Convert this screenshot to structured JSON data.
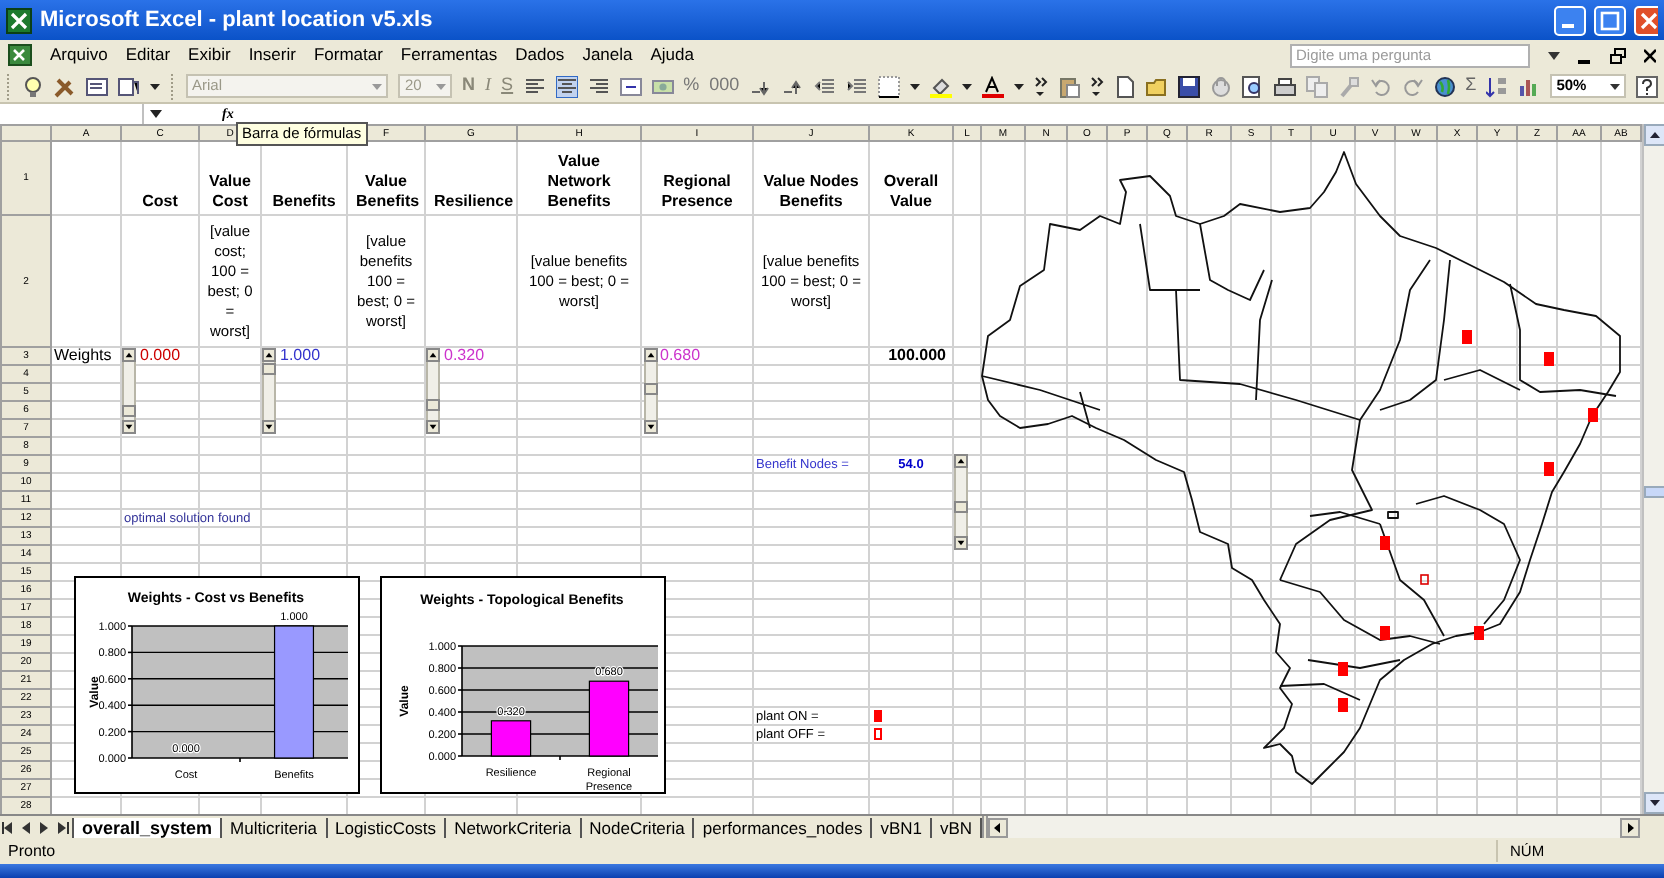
{
  "window": {
    "title": "Microsoft Excel - plant location v5.xls"
  },
  "menu": [
    "Arquivo",
    "Editar",
    "Exibir",
    "Inserir",
    "Formatar",
    "Ferramentas",
    "Dados",
    "Janela",
    "Ajuda"
  ],
  "help_search": {
    "placeholder": "Digite uma pergunta"
  },
  "toolbar": {
    "font": "Arial",
    "font_size": "20",
    "format_buttons": [
      "N",
      "I",
      "S"
    ],
    "percent": "%",
    "thousands": "000",
    "sum": "Σ",
    "zoom": "50%"
  },
  "formula_bar": {
    "function_label": "fx",
    "tooltip": "Barra de fórmulas"
  },
  "columns": [
    "A",
    "C",
    "D",
    "F",
    "G",
    "H",
    "I",
    "J",
    "K",
    "L",
    "M",
    "N",
    "O",
    "P",
    "Q",
    "R",
    "S",
    "T",
    "U",
    "V",
    "W",
    "X",
    "Y",
    "Z",
    "AA",
    "AB"
  ],
  "rows": [
    {
      "number": "1",
      "cells": {
        "C": {
          "text": "Cost",
          "kind": "header"
        },
        "D": {
          "text": "Value Cost",
          "kind": "header"
        },
        "E": {
          "text": "Benefits",
          "kind": "header"
        },
        "F": {
          "text": "Value Benefits",
          "kind": "header"
        },
        "G": {
          "text": "Resilience",
          "kind": "header"
        },
        "H": {
          "text": "Value Network Benefits",
          "kind": "header"
        },
        "I": {
          "text": "Regional Presence",
          "kind": "header"
        },
        "J": {
          "text": "Value Nodes Benefits",
          "kind": "header"
        },
        "K": {
          "text": "Overall Value",
          "kind": "header"
        }
      }
    },
    {
      "number": "2",
      "cells": {
        "D": {
          "text": "[value cost; 100 = best; 0 = worst]",
          "kind": "note"
        },
        "F": {
          "text": "[value benefits 100 = best; 0 = worst]",
          "kind": "note"
        },
        "H": {
          "text": "[value benefits 100 = best; 0 = worst]",
          "kind": "note"
        },
        "J": {
          "text": "[value benefits 100 = best; 0 = worst]",
          "kind": "note"
        }
      }
    },
    {
      "number": "3",
      "cells": {
        "A": {
          "text": "Weights",
          "kind": "label"
        },
        "C": {
          "text": "0.000",
          "kind": "value",
          "color": "#cc0000"
        },
        "E": {
          "text": "1.000",
          "kind": "value",
          "color": "#3333cc"
        },
        "G": {
          "text": "0.320",
          "kind": "value",
          "color": "#cc33cc"
        },
        "I": {
          "text": "0.680",
          "kind": "value",
          "color": "#cc33cc"
        },
        "K": {
          "text": "100.000",
          "kind": "total"
        }
      }
    },
    {
      "number": "4"
    },
    {
      "number": "5"
    },
    {
      "number": "6"
    },
    {
      "number": "7"
    },
    {
      "number": "8"
    },
    {
      "number": "9",
      "cells": {
        "J": {
          "text": "Benefit Nodes =",
          "kind": "small",
          "color": "#3333cc"
        },
        "K": {
          "text": "54.0",
          "kind": "small-total",
          "color": "#0000cc"
        }
      }
    },
    {
      "number": "10"
    },
    {
      "number": "11"
    },
    {
      "number": "12",
      "cells": {
        "C": {
          "text": "optimal solution found",
          "kind": "small",
          "color": "#333399"
        }
      }
    },
    {
      "number": "13"
    },
    {
      "number": "14"
    },
    {
      "number": "15"
    },
    {
      "number": "16"
    },
    {
      "number": "17"
    },
    {
      "number": "18"
    },
    {
      "number": "19"
    },
    {
      "number": "20"
    },
    {
      "number": "21"
    },
    {
      "number": "22"
    },
    {
      "number": "23",
      "cells": {
        "J": {
          "text": "plant ON =",
          "kind": "small"
        },
        "K": {
          "kind": "marker",
          "on": true
        }
      }
    },
    {
      "number": "24",
      "cells": {
        "J": {
          "text": "plant OFF =",
          "kind": "small"
        },
        "K": {
          "kind": "marker",
          "on": false
        }
      }
    },
    {
      "number": "25"
    },
    {
      "number": "26"
    },
    {
      "number": "27"
    },
    {
      "number": "28"
    }
  ],
  "charts": [
    {
      "chart_data": {
        "type": "bar",
        "title": "Weights - Cost vs Benefits",
        "ylabel": "Value",
        "categories": [
          "Cost",
          "Benefits"
        ],
        "series": [
          {
            "color": "#9999ff",
            "values": [
              0,
              1
            ]
          }
        ],
        "grid": true,
        "ylim": [
          0,
          1
        ],
        "yticks": [
          {
            "value": 1,
            "label": "1.000"
          },
          {
            "value": 0.8,
            "label": "0.800"
          },
          {
            "value": 0.6,
            "label": "0.600"
          },
          {
            "value": 0.4,
            "label": "0.400"
          },
          {
            "value": 0.2,
            "label": "0.200"
          },
          {
            "value": 0,
            "label": "0.000"
          }
        ],
        "value_labels": [
          "0.000",
          "1.000"
        ]
      }
    },
    {
      "chart_data": {
        "type": "bar",
        "title": "Weights - Topological Benefits",
        "ylabel": "Value",
        "categories": [
          "Resilience",
          "Regional Presence"
        ],
        "series": [
          {
            "color": "#ff00ff",
            "values": [
              0.32,
              0.68
            ]
          }
        ],
        "grid": true,
        "ylim": [
          0,
          1
        ],
        "yticks": [
          {
            "value": 1,
            "label": "1.000"
          },
          {
            "value": 0.8,
            "label": "0.800"
          },
          {
            "value": 0.6,
            "label": "0.600"
          },
          {
            "value": 0.4,
            "label": "0.400"
          },
          {
            "value": 0.2,
            "label": "0.200"
          },
          {
            "value": 0,
            "label": "0.000"
          }
        ],
        "value_labels": [
          "0.320",
          "0.680"
        ]
      }
    }
  ],
  "plants": [
    {
      "on": true
    },
    {
      "on": true
    },
    {
      "on": true
    },
    {
      "on": true
    },
    {
      "on": true
    },
    {
      "on": false
    },
    {
      "on": true
    },
    {
      "on": true
    },
    {
      "on": true
    },
    {
      "on": true
    }
  ],
  "sheet_tabs": [
    {
      "label": "overall_system",
      "selected": true
    },
    {
      "label": "Multicriteria",
      "selected": false
    },
    {
      "label": "LogisticCosts",
      "selected": false
    },
    {
      "label": "NetworkCriteria",
      "selected": false
    },
    {
      "label": "NodeCriteria",
      "selected": false
    },
    {
      "label": "performances_nodes",
      "selected": false
    },
    {
      "label": "vBN1",
      "selected": false
    },
    {
      "label": "vBN",
      "selected": false
    }
  ],
  "status_bar": {
    "text": "Pronto",
    "num_lock": "NÚM"
  }
}
